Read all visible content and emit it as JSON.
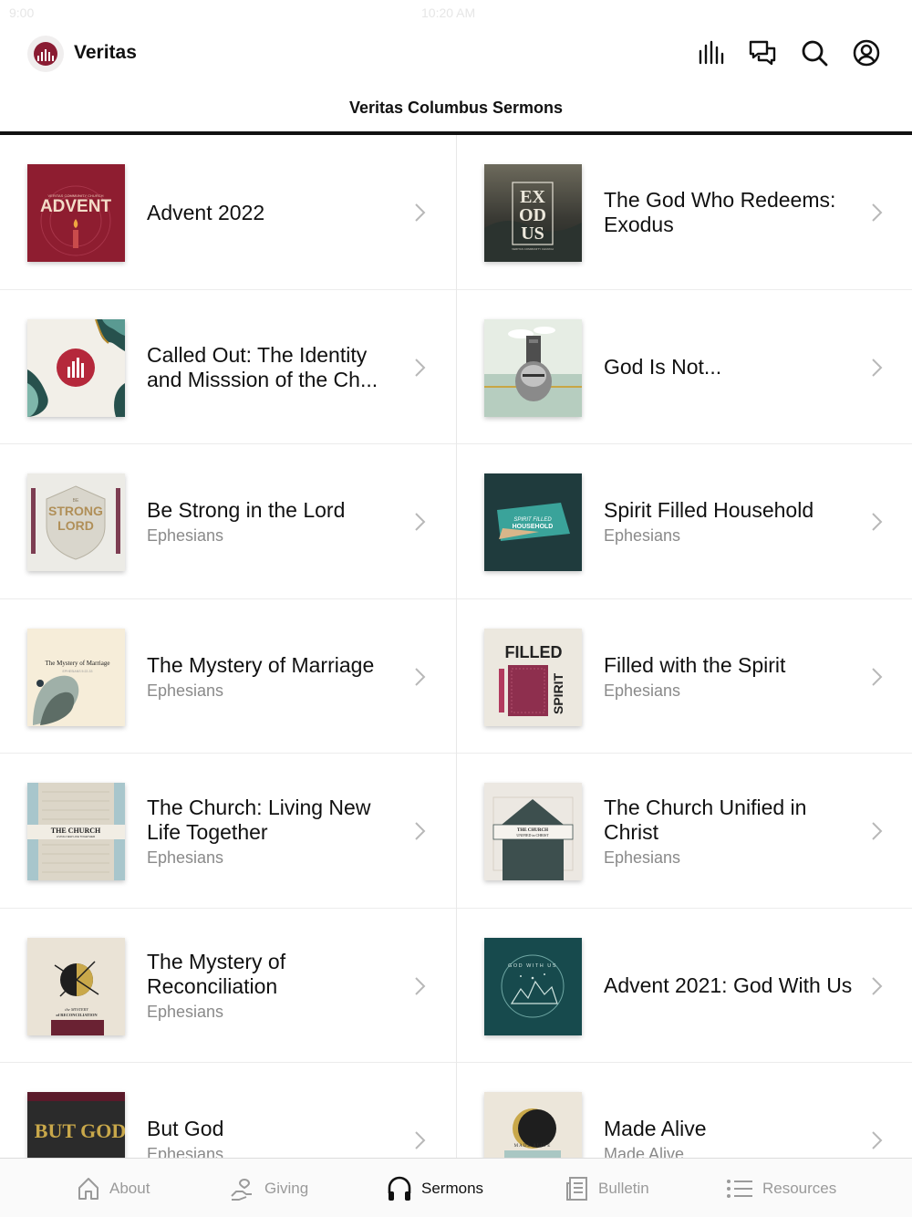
{
  "status_bar": {
    "time": "9:00",
    "clock": "10:20 AM"
  },
  "header": {
    "app_name": "Veritas",
    "icons": [
      "chart-bars-icon",
      "chat-bubbles-icon",
      "search-icon",
      "account-icon"
    ]
  },
  "page_title": "Veritas Columbus Sermons",
  "series": [
    {
      "title": "Advent 2022",
      "subtitle": "",
      "art_text": "ADVENT",
      "art_small": "VERITAS COMMUNITY CHURCH"
    },
    {
      "title": "The God Who Redeems: Exodus",
      "subtitle": "",
      "art_text": "EX OD US",
      "art_small": "VERITAS COMMUNITY CHURCH"
    },
    {
      "title": "Called Out: The Identity and Misssion of the Ch...",
      "subtitle": "",
      "art_text": "",
      "art_small": ""
    },
    {
      "title": "God Is Not...",
      "subtitle": "",
      "art_text": "",
      "art_small": ""
    },
    {
      "title": "Be Strong in the Lord",
      "subtitle": "Ephesians",
      "art_text": "STRONG",
      "art_small": "LORD"
    },
    {
      "title": "Spirit Filled Household",
      "subtitle": "Ephesians",
      "art_text": "SPIRIT FILLED",
      "art_small": "HOUSEHOLD"
    },
    {
      "title": "The Mystery of Marriage",
      "subtitle": "Ephesians",
      "art_text": "The Mystery of Marriage",
      "art_small": "EPHESIANS 5:22-33"
    },
    {
      "title": "Filled with the Spirit",
      "subtitle": "Ephesians",
      "art_text": "FILLED",
      "art_small": "SPIRIT"
    },
    {
      "title": "The Church: Living New Life Together",
      "subtitle": "Ephesians",
      "art_text": "THE CHURCH",
      "art_small": "LIVING NEW LIFE TOGETHER"
    },
    {
      "title": "The Church Unified in Christ",
      "subtitle": "Ephesians",
      "art_text": "THE CHURCH",
      "art_small": "UNIFIED in CHRIST"
    },
    {
      "title": "The Mystery of Reconciliation",
      "subtitle": "Ephesians",
      "art_text": "the MYSTERY",
      "art_small": "of RECONCILIATION"
    },
    {
      "title": "Advent 2021: God With Us",
      "subtitle": "",
      "art_text": "GOD WITH US",
      "art_small": ""
    },
    {
      "title": "But God",
      "subtitle": "Ephesians",
      "art_text": "BUT GOD",
      "art_small": ""
    },
    {
      "title": "Made Alive",
      "subtitle": "Made Alive",
      "art_text": "MADE ALIVE",
      "art_small": ""
    }
  ],
  "tabs": [
    {
      "label": "About",
      "icon": "home-icon",
      "active": false
    },
    {
      "label": "Giving",
      "icon": "giving-hand-icon",
      "active": false
    },
    {
      "label": "Sermons",
      "icon": "headphones-icon",
      "active": true
    },
    {
      "label": "Bulletin",
      "icon": "bulletin-icon",
      "active": false
    },
    {
      "label": "Resources",
      "icon": "list-icon",
      "active": false
    }
  ],
  "colors": {
    "brand": "#8a1c33",
    "text": "#111111",
    "muted": "#8a8a8a",
    "divider": "#ececec"
  }
}
